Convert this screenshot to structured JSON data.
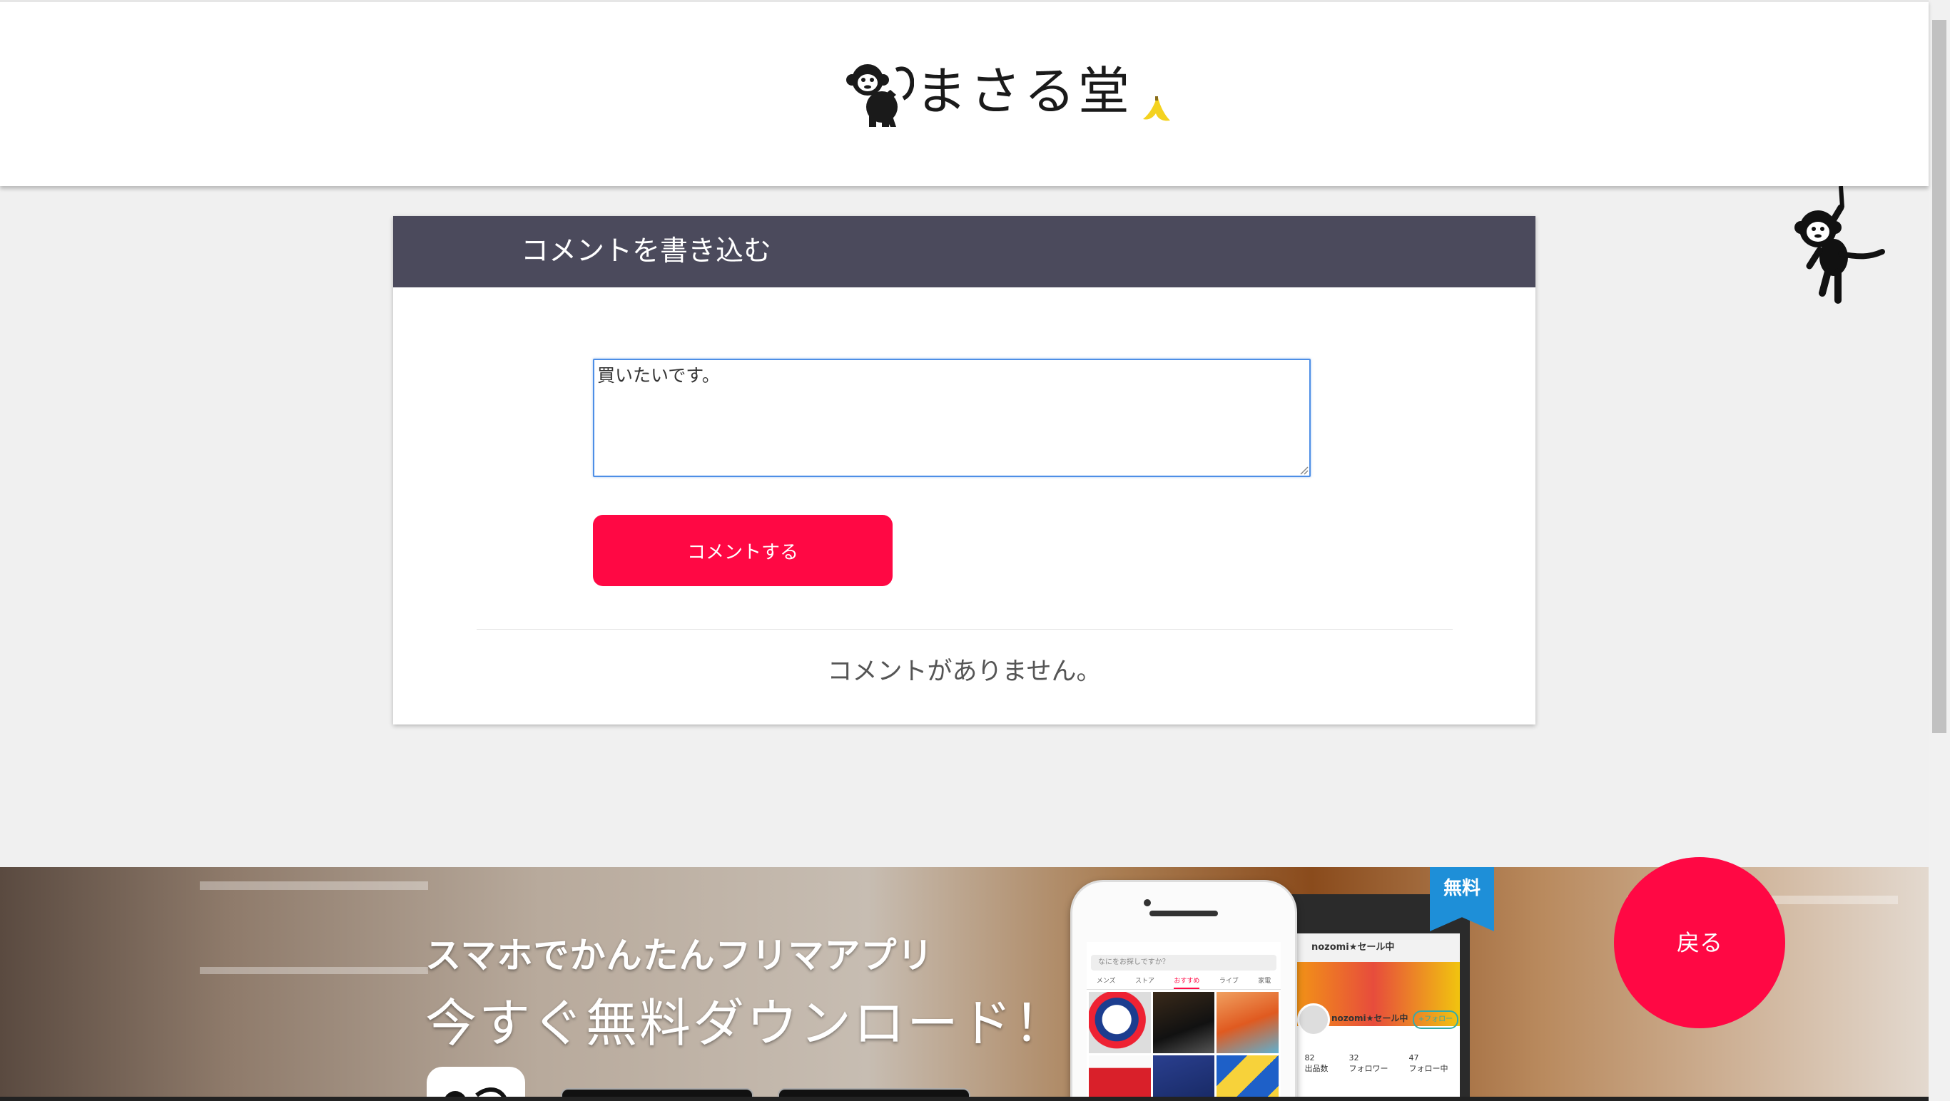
{
  "header": {
    "site_name": "まさる堂",
    "logo_icon": "monkey-icon",
    "decoration_icon": "banana-icon"
  },
  "comment_form": {
    "title": "コメントを書き込む",
    "textarea_value": "買いたいです。",
    "submit_label": "コメントする",
    "empty_message": "コメントがありません。"
  },
  "banner": {
    "line1": "スマホでかんたんフリマアプリ",
    "line2": "今すぐ無料ダウンロード！",
    "free_badge": "無料",
    "phone_search_placeholder": "なにをお探しですか？",
    "phone_tabs": [
      "メンズ",
      "ストア",
      "おすすめ",
      "ライブ",
      "家電"
    ],
    "profile_name": "nozomi★セール中",
    "follow_label": "+フォロー",
    "stats": [
      {
        "value": "82",
        "label": "出品数"
      },
      {
        "value": "32",
        "label": "フォロワー"
      },
      {
        "value": "47",
        "label": "フォロー中"
      }
    ]
  },
  "back_button": {
    "label": "戻る"
  },
  "colors": {
    "accent": "#ff0844",
    "card_header": "#4b4a5c",
    "focus_border": "#4d8ee6",
    "page_bg": "#f0f0f0"
  }
}
